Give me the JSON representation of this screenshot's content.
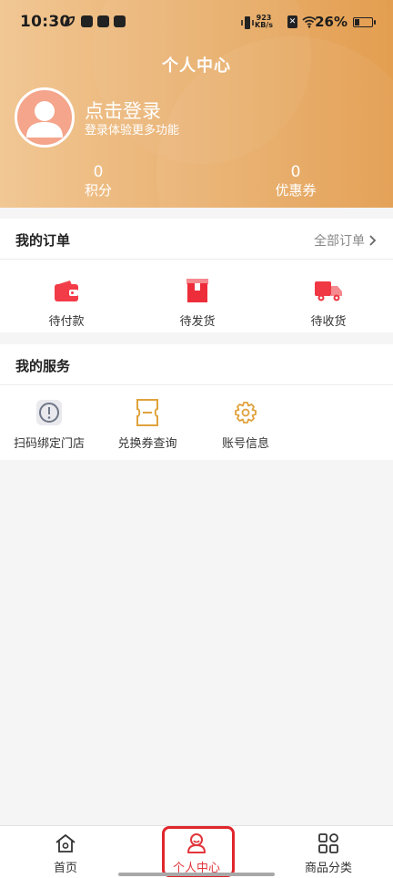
{
  "status_bar": {
    "time": "10:30",
    "net_speed_value": "923",
    "net_speed_unit": "KB/s",
    "battery": "26%"
  },
  "header": {
    "title": "个人中心",
    "login_title": "点击登录",
    "login_subtitle": "登录体验更多功能",
    "points_value": "0",
    "points_label": "积分",
    "coupons_value": "0",
    "coupons_label": "优惠券"
  },
  "orders": {
    "title": "我的订单",
    "all_orders_label": "全部订单",
    "items": [
      {
        "label": "待付款",
        "icon": "wallet-icon"
      },
      {
        "label": "待发货",
        "icon": "package-icon"
      },
      {
        "label": "待收货",
        "icon": "truck-icon"
      }
    ]
  },
  "services": {
    "title": "我的服务",
    "items": [
      {
        "label": "扫码绑定门店",
        "icon": "info-circle-icon"
      },
      {
        "label": "兑换券查询",
        "icon": "voucher-icon"
      },
      {
        "label": "账号信息",
        "icon": "gear-icon"
      }
    ]
  },
  "bottom_nav": {
    "items": [
      {
        "label": "首页",
        "icon": "home-icon"
      },
      {
        "label": "个人中心",
        "icon": "user-icon"
      },
      {
        "label": "商品分类",
        "icon": "grid-icon"
      }
    ],
    "active_index": 1
  },
  "colors": {
    "accent": "#e2363c",
    "header_start": "#f1c794",
    "header_end": "#e39e50"
  }
}
